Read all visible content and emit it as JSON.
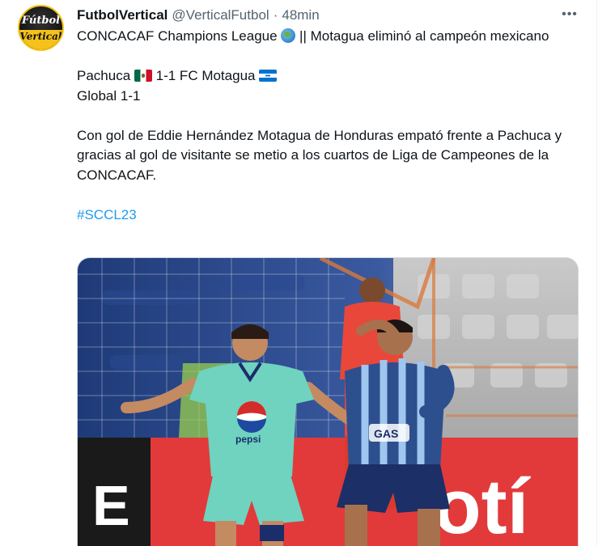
{
  "tweet": {
    "author_name": "FutbolVertical",
    "author_handle": "@VerticalFutbol",
    "separator": "·",
    "time": "48min",
    "more_label": "•••",
    "avatar_text_line1": "Fútbol",
    "avatar_text_line2": "Vertical",
    "line1_a": "CONCACAF Champions League",
    "line1_b": "|| Motagua eliminó al campeón mexicano",
    "score_team1": "Pachuca",
    "score_result": "1-1 FC Motagua",
    "global": "Global 1-1",
    "paragraph": "Con gol de Eddie Hernández Motagua de Honduras empató frente a Pachuca y gracias al gol de visitante se metio a los cuartos de Liga de Campeones de la CONCACAF.",
    "hashtag": "#SCCL23",
    "icons": {
      "globe": "globe-americas-icon",
      "flag_mexico": "mexico-flag-icon",
      "flag_honduras": "honduras-flag-icon",
      "more": "more-horizontal-icon"
    },
    "colors": {
      "text": "#0f1419",
      "secondary": "#536471",
      "link": "#1d9bf0",
      "motagua_kit": "#6fd3c0",
      "pachuca_kit": "#2d4f8e"
    }
  },
  "photo": {
    "shirt_text_pepsi": "pepsi",
    "shirt_text_gas": "GAS",
    "board_text": "otí",
    "board_letter": "E"
  }
}
